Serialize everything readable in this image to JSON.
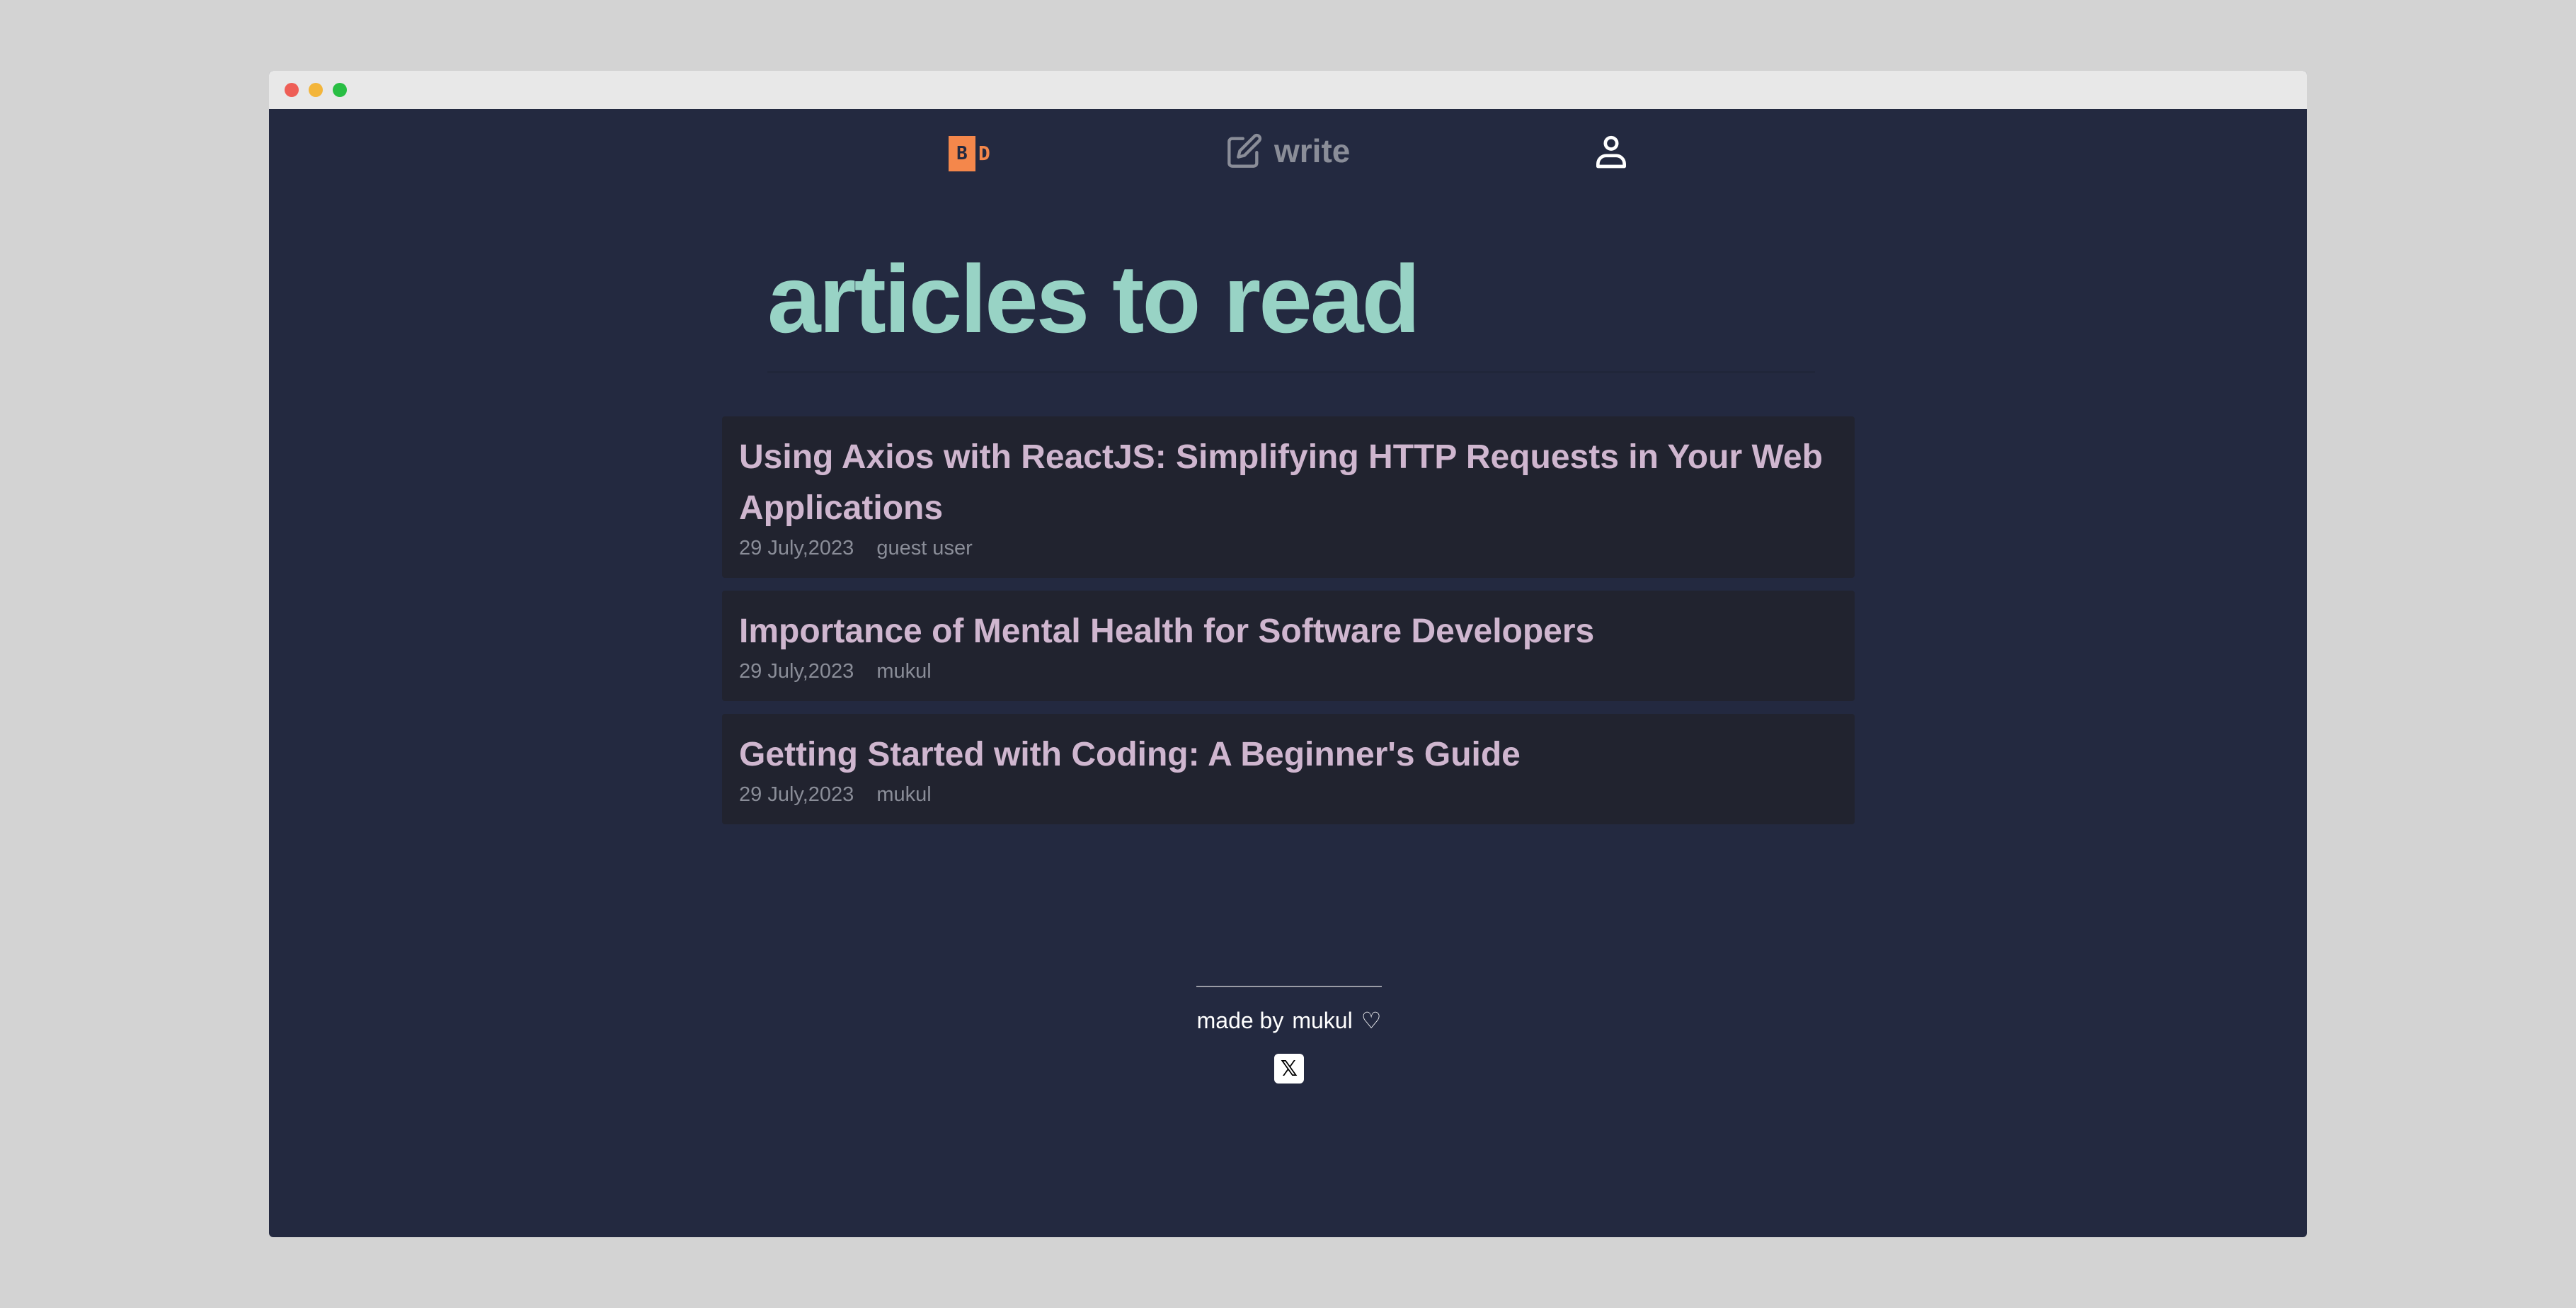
{
  "nav": {
    "logo_b": "B",
    "logo_d": "D",
    "write_label": "write"
  },
  "main": {
    "heading": "articles to read",
    "articles": [
      {
        "title": "Using Axios with ReactJS: Simplifying HTTP Requests in Your Web Applications",
        "date": "29 July,2023",
        "author": "guest user"
      },
      {
        "title": "Importance of Mental Health for Software Developers",
        "date": "29 July,2023",
        "author": "mukul"
      },
      {
        "title": "Getting Started with Coding: A Beginner's Guide",
        "date": "29 July,2023",
        "author": "mukul"
      }
    ]
  },
  "footer": {
    "made_by": "made by",
    "author": "mukul",
    "heart": "♡",
    "x_icon": "𝕏"
  },
  "colors": {
    "background": "#232940",
    "heading": "#98d3c5",
    "card": "#21232f",
    "card_title": "#cfb6cf",
    "logo": "#f4874b"
  }
}
